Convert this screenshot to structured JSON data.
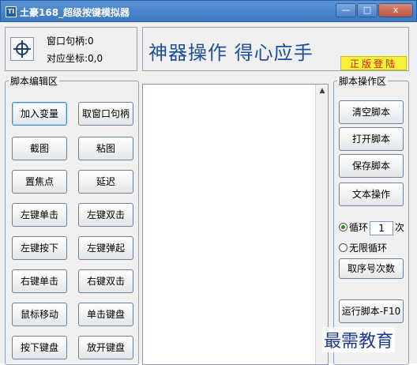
{
  "window": {
    "icon_text": "TI",
    "title": "土豪168_超级按键模拟器",
    "min_icon": "minimize-icon",
    "max_icon": "maximize-icon",
    "close_icon": "close-icon",
    "min_glyph": "—",
    "max_glyph": "□",
    "close_glyph": "x"
  },
  "header": {
    "window_handle_label": "窗口句柄:0",
    "coords_label": "对应坐标:0,0",
    "slogan": "神器操作 得心应手",
    "login_badge": "正版登陆"
  },
  "editor_group": {
    "label": "脚本编辑区",
    "buttons": [
      [
        "加入变量",
        "取窗口句柄"
      ],
      [
        "截图",
        "粘图"
      ],
      [
        "置焦点",
        "延迟"
      ],
      [
        "左键单击",
        "左键双击"
      ],
      [
        "左键按下",
        "左键弹起"
      ],
      [
        "右键单击",
        "右键双击"
      ],
      [
        "鼠标移动",
        "单击键盘"
      ],
      [
        "按下键盘",
        "放开键盘"
      ]
    ]
  },
  "script_area": {
    "scroll_up_glyph": "▲"
  },
  "ops_group": {
    "label": "脚本操作区",
    "clear": "清空脚本",
    "open": "打开脚本",
    "save": "保存脚本",
    "text_ops": "文本操作",
    "loop_label": "循环",
    "loop_value": "1",
    "loop_unit": "次",
    "infinite_label": "无限循环",
    "seq_count": "取序号次数",
    "run": "运行脚本-F10"
  },
  "watermark": "最需教育",
  "colors": {
    "title_bar": "#3c78c2",
    "slogan": "#1d4f9c",
    "badge_bg": "#f7f13a",
    "badge_text": "#e01010"
  }
}
